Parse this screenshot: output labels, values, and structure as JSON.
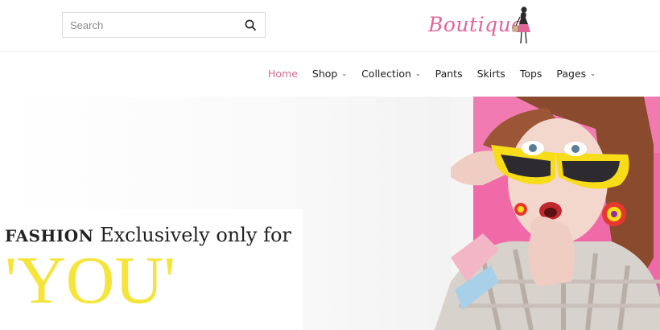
{
  "search": {
    "placeholder": "Search",
    "value": "",
    "icon": "search-icon"
  },
  "logo": {
    "text": "Boutique"
  },
  "nav": {
    "items": [
      {
        "label": "Home",
        "active": true,
        "dropdown": false
      },
      {
        "label": "Shop",
        "active": false,
        "dropdown": true
      },
      {
        "label": "Collection",
        "active": false,
        "dropdown": true
      },
      {
        "label": "Pants",
        "active": false,
        "dropdown": false
      },
      {
        "label": "Skirts",
        "active": false,
        "dropdown": false
      },
      {
        "label": "Tops",
        "active": false,
        "dropdown": false
      },
      {
        "label": "Pages",
        "active": false,
        "dropdown": true
      }
    ],
    "chevron": "⌄"
  },
  "hero": {
    "line_bold": "FASHION",
    "line_rest": " Exclusively only for",
    "big": "'YOU'"
  },
  "colors": {
    "accent": "#d16e8e",
    "logo_pink": "#e0679a",
    "hero_yellow": "#f5e43a",
    "hero_pink": "#f06aa8"
  }
}
